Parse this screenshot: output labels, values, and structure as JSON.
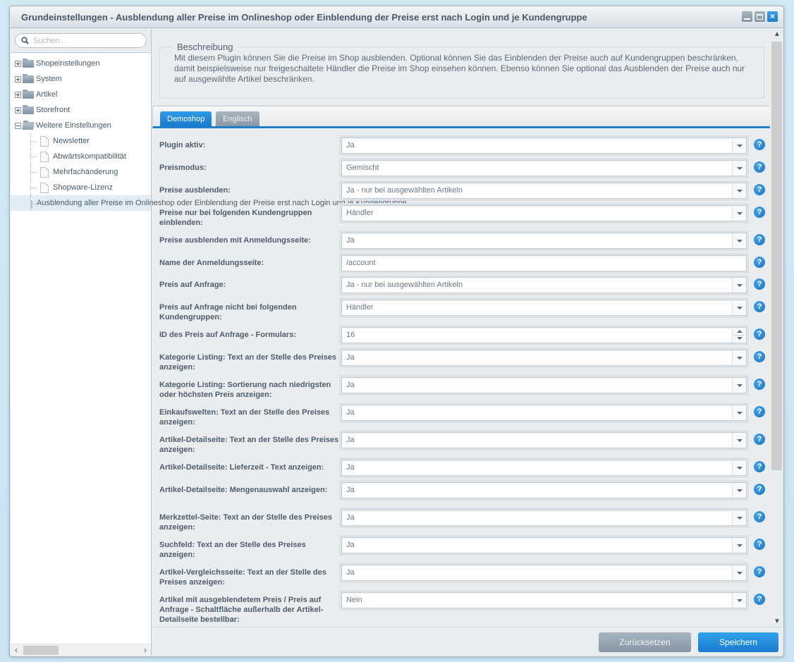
{
  "window": {
    "title": "Grundeinstellungen - Ausblendung aller Preise im Onlineshop oder Einblendung der Preise erst nach Login und je Kundengruppe",
    "buttons": {
      "minimize": "minimize-icon",
      "maximize": "maximize-icon",
      "close": "×"
    }
  },
  "sidebar": {
    "search_placeholder": "Suchen...",
    "tree": [
      {
        "label": "Shopeinstellungen",
        "type": "folder",
        "expanded": false
      },
      {
        "label": "System",
        "type": "folder",
        "expanded": false
      },
      {
        "label": "Artikel",
        "type": "folder",
        "expanded": false
      },
      {
        "label": "Storefront",
        "type": "folder",
        "expanded": false
      },
      {
        "label": "Weitere Einstellungen",
        "type": "folder",
        "expanded": true
      },
      {
        "label": "Newsletter",
        "type": "leaf"
      },
      {
        "label": "Abwärtskompatibilität",
        "type": "leaf"
      },
      {
        "label": "Mehrfachänderung",
        "type": "leaf"
      },
      {
        "label": "Shopware-Lizenz",
        "type": "leaf"
      },
      {
        "label": "Ausblendung aller Preise im Onlineshop oder Einblendung der Preise erst nach Login und je Kundengruppe",
        "type": "leaf",
        "selected": true
      }
    ]
  },
  "description": {
    "legend": "Beschreibung",
    "text": "Mit diesem Plugin können Sie die Preise im Shop ausblenden. Optional können Sie das Einblenden der Preise auch auf Kundengruppen beschränken, damit beispielsweise nur freigeschaltete Händler die Preise im Shop einsehen können. Ebenso können Sie optional das Ausblenden der Preise auch nur auf ausgewählte Artikel beschränken."
  },
  "tabs": [
    {
      "label": "Demoshop",
      "active": true
    },
    {
      "label": "Englisch",
      "active": false
    }
  ],
  "fields": [
    {
      "label": "Plugin aktiv:",
      "value": "Ja",
      "type": "select"
    },
    {
      "label": "Preismodus:",
      "value": "Gemischt",
      "type": "select"
    },
    {
      "label": "Preise ausblenden:",
      "value": "Ja - nur bei ausgewählten Artikeln",
      "type": "select"
    },
    {
      "label": "Preise nur bei folgenden Kundengruppen einblenden:",
      "value": "Händler",
      "type": "select"
    },
    {
      "label": "Preise ausblenden mit Anmeldungsseite:",
      "value": "Ja",
      "type": "select"
    },
    {
      "label": "Name der Anmeldungsseite:",
      "value": "/account",
      "type": "text"
    },
    {
      "label": "Preis auf Anfrage:",
      "value": "Ja - nur bei ausgewählten Artikeln",
      "type": "select"
    },
    {
      "label": "Preis auf Anfrage nicht bei folgenden Kundengruppen:",
      "value": "Händler",
      "type": "select"
    },
    {
      "label": "ID des Preis auf Anfrage - Formulars:",
      "value": "16",
      "type": "number"
    },
    {
      "label": "Kategorie Listing: Text an der Stelle des Preises anzeigen:",
      "value": "Ja",
      "type": "select"
    },
    {
      "label": "Kategorie Listing: Sortierung nach niedrigsten oder höchsten Preis anzeigen:",
      "value": "Ja",
      "type": "select"
    },
    {
      "label": "Einkaufswelten: Text an der Stelle des Preises anzeigen:",
      "value": "Ja",
      "type": "select"
    },
    {
      "label": "Artikel-Detailseite: Text an der Stelle des Preises anzeigen:",
      "value": "Ja",
      "type": "select"
    },
    {
      "label": "Artikel-Detailseite: Lieferzeit - Text anzeigen:",
      "value": "Ja",
      "type": "select"
    },
    {
      "label": "Artikel-Detailseite: Mengenauswahl anzeigen:",
      "value": "Ja",
      "type": "select"
    },
    {
      "label": "Merkzettel-Seite: Text an der Stelle des Preises anzeigen:",
      "value": "Ja",
      "type": "select"
    },
    {
      "label": "Suchfeld: Text an der Stelle des Preises anzeigen:",
      "value": "Ja",
      "type": "select"
    },
    {
      "label": "Artikel-Vergleichsseite: Text an der Stelle des Preises anzeigen:",
      "value": "Ja",
      "type": "select"
    },
    {
      "label": "Artikel mit ausgeblendetem Preis / Preis auf Anfrage - Schaltfläche außerhalb der Artikel-Detailseite bestellbar:",
      "value": "Nein",
      "type": "select"
    }
  ],
  "help_glyph": "?",
  "footer": {
    "reset_label": "Zurücksetzen",
    "save_label": "Speichern"
  },
  "colors": {
    "accent": "#1f7fc9",
    "save": "#1b7ad0",
    "reset": "#8795a3"
  }
}
